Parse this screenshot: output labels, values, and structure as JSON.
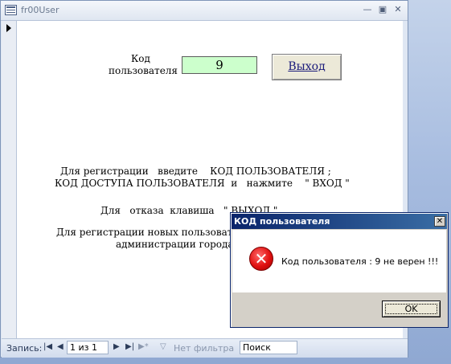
{
  "window": {
    "title": "fr00User"
  },
  "form": {
    "code_label_line1": "Код",
    "code_label_line2": "пользователя :",
    "code_value": "9",
    "exit_button": "Выход",
    "instr_line1": "Для регистрации   введите    КОД ПОЛЬЗОВАТЕЛЯ ;",
    "instr_line2": "КОД ДОСТУПА ПОЛЬЗОВАТЕЛЯ  и   нажмите    \" ВХОД \"",
    "instr_line3": "Для   отказа  клавиша   \" ВЫХОД \"",
    "instr_line4": "Для регистрации новых пользователей обр",
    "instr_line5": "администрации города Хабар"
  },
  "navbar": {
    "record_label": "Запись:",
    "record_position": "1 из 1",
    "filter_label": "Нет фильтра",
    "search_label": "Поиск"
  },
  "dialog": {
    "title": "КОД пользователя",
    "message": "Код пользователя : 9 не верен !!!",
    "ok_button": "OK"
  }
}
